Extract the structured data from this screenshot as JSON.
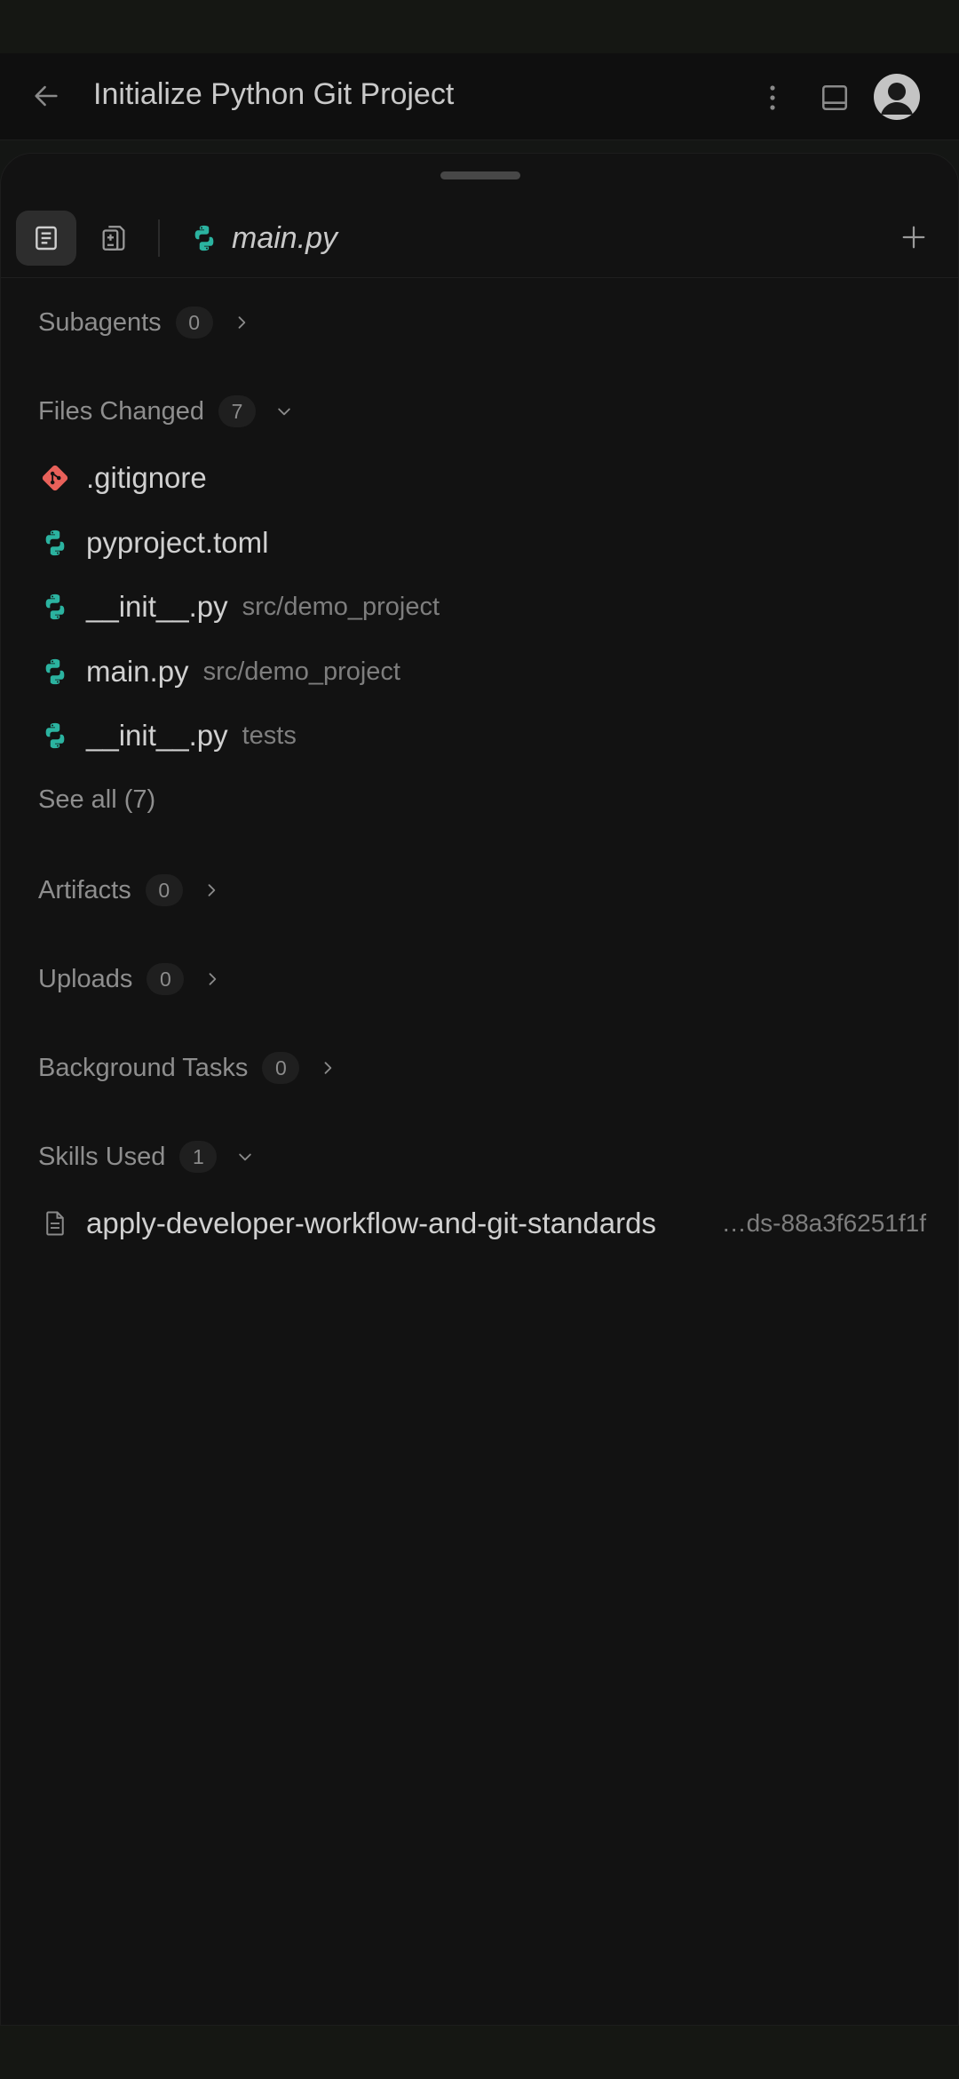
{
  "header": {
    "title": "Initialize Python Git Project",
    "icons": {
      "back": "arrow-left-icon",
      "more": "kebab-menu-icon",
      "panel": "panel-layout-icon",
      "avatar": "user-avatar-icon"
    }
  },
  "toolbar": {
    "open_file": "main.py",
    "icons": {
      "summary": "document-lines-icon",
      "diff": "file-diff-icon",
      "add": "plus-icon"
    }
  },
  "sections": {
    "subagents": {
      "label": "Subagents",
      "count": "0"
    },
    "files_changed": {
      "label": "Files Changed",
      "count": "7"
    },
    "artifacts": {
      "label": "Artifacts",
      "count": "0"
    },
    "uploads": {
      "label": "Uploads",
      "count": "0"
    },
    "background_tasks": {
      "label": "Background Tasks",
      "count": "0"
    },
    "skills_used": {
      "label": "Skills Used",
      "count": "1"
    }
  },
  "files": [
    {
      "name": ".gitignore",
      "path": "",
      "icon": "git-icon"
    },
    {
      "name": "pyproject.toml",
      "path": "",
      "icon": "python-icon"
    },
    {
      "name": "__init__.py",
      "path": "src/demo_project",
      "icon": "python-icon"
    },
    {
      "name": "main.py",
      "path": "src/demo_project",
      "icon": "python-icon"
    },
    {
      "name": "__init__.py",
      "path": "tests",
      "icon": "python-icon"
    }
  ],
  "see_all": "See all (7)",
  "skills": [
    {
      "name": "apply-developer-workflow-and-git-standards",
      "hash": "…ds-88a3f6251f1f",
      "icon": "document-icon"
    }
  ],
  "colors": {
    "background": "#121212",
    "python_icon": "#2bb3a0",
    "git_icon": "#e8615a",
    "muted_text": "#8e8e8e"
  }
}
